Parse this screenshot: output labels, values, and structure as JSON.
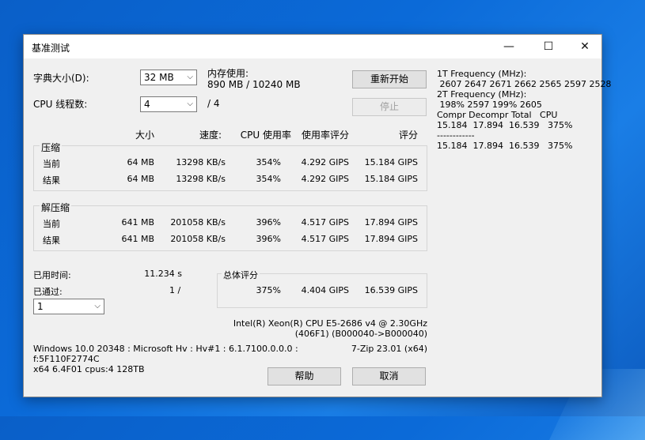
{
  "window": {
    "title": "基准测试",
    "minimize_glyph": "—",
    "maximize_glyph": "☐",
    "close_glyph": "✕"
  },
  "settings": {
    "dict_label": "字典大小(D):",
    "dict_value": "32 MB",
    "threads_label": "CPU 线程数:",
    "threads_value": "4",
    "threads_total": "/ 4",
    "memory_label": "内存使用:",
    "memory_value": "890 MB / 10240 MB"
  },
  "buttons": {
    "restart": "重新开始",
    "stop": "停止",
    "help": "帮助",
    "cancel": "取消"
  },
  "table": {
    "headers": {
      "size": "大小",
      "speed": "速度:",
      "cpu_usage": "CPU 使用率",
      "rating_per_usage": "使用率评分",
      "rating": "评分"
    },
    "compress": {
      "label": "压缩",
      "rows": [
        {
          "name": "当前",
          "size": "64 MB",
          "speed": "13298 KB/s",
          "usage": "354%",
          "rpu": "4.292 GIPS",
          "rating": "15.184 GIPS"
        },
        {
          "name": "结果",
          "size": "64 MB",
          "speed": "13298 KB/s",
          "usage": "354%",
          "rpu": "4.292 GIPS",
          "rating": "15.184 GIPS"
        }
      ]
    },
    "decompress": {
      "label": "解压缩",
      "rows": [
        {
          "name": "当前",
          "size": "641 MB",
          "speed": "201058 KB/s",
          "usage": "396%",
          "rpu": "4.517 GIPS",
          "rating": "17.894 GIPS"
        },
        {
          "name": "结果",
          "size": "641 MB",
          "speed": "201058 KB/s",
          "usage": "396%",
          "rpu": "4.517 GIPS",
          "rating": "17.894 GIPS"
        }
      ]
    }
  },
  "elapsed": {
    "label": "已用时间:",
    "value": "11.234 s",
    "passes_label": "已通过:",
    "passes_value": "1 /",
    "passes_select": "1"
  },
  "total": {
    "label": "总体评分",
    "usage": "375%",
    "rpu": "4.404 GIPS",
    "rating": "16.539 GIPS"
  },
  "cpu_info": {
    "line1": "Intel(R) Xeon(R) CPU E5-2686 v4 @ 2.30GHz",
    "line2": "(406F1) (B000040->B000040)"
  },
  "system_info": {
    "line1": "Windows 10.0 20348 : Microsoft Hv : Hv#1 : 6.1.7100.0.0.0 :",
    "line2": "f:5F110F2774C",
    "line3": "x64 6.4F01 cpus:4 128TB",
    "version": "7-Zip 23.01 (x64)"
  },
  "freq_panel": {
    "lines": [
      "1T Frequency (MHz):",
      " 2607 2647 2671 2662 2565 2597 2528",
      "2T Frequency (MHz):",
      " 198% 2597 199% 2605",
      "Compr Decompr Total   CPU",
      "15.184  17.894  16.539   375%",
      "------------",
      "15.184  17.894  16.539   375%"
    ]
  }
}
